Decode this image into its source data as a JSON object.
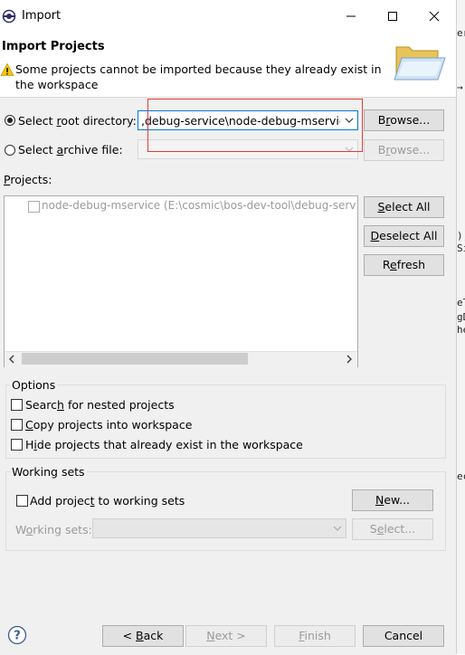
{
  "window": {
    "title": "Import",
    "minimize_icon": "minimize-icon",
    "maximize_icon": "maximize-icon",
    "close_icon": "close-icon"
  },
  "header": {
    "page_title": "Import Projects",
    "warning_icon": "warning-icon",
    "warning_text": "Some projects cannot be imported because they already exist in the workspace",
    "banner_icon": "folder-import-icon"
  },
  "source": {
    "root_directory": {
      "label_pre": "Select ",
      "label_ul": "r",
      "label_post": "oot directory:",
      "value": ",debug-service\\node-debug-mservice",
      "selected": true,
      "browse_pre": "B",
      "browse_ul": "r",
      "browse_post": "owse..."
    },
    "archive_file": {
      "label_pre": "Select ",
      "label_ul": "a",
      "label_post": "rchive file:",
      "value": "",
      "selected": false,
      "browse_pre": "B",
      "browse_ul": "r",
      "browse_post": "owse..."
    }
  },
  "projects": {
    "label_ul": "P",
    "label_post": "rojects:",
    "items": [
      {
        "label": "node-debug-mservice (E:\\cosmic\\bos-dev-tool\\debug-serv",
        "checked": false,
        "disabled": true
      }
    ],
    "buttons": {
      "select_all_ul": "S",
      "select_all_post": "elect All",
      "deselect_all_ul": "D",
      "deselect_all_post": "eselect All",
      "refresh_pre": "R",
      "refresh_ul": "e",
      "refresh_post": "fresh"
    }
  },
  "options": {
    "title": "Options",
    "items": [
      {
        "pre": "Searc",
        "ul": "h",
        "post": " for nested projects",
        "checked": false
      },
      {
        "pre": "",
        "ul": "C",
        "post": "opy projects into workspace",
        "checked": false
      },
      {
        "pre": "H",
        "ul": "i",
        "post": "de projects that already exist in the workspace",
        "checked": false
      }
    ]
  },
  "working_sets": {
    "title": "Working sets",
    "add_pre": "Add projec",
    "add_ul": "t",
    "add_post": " to working sets",
    "add_checked": false,
    "new_ul": "N",
    "new_post": "ew...",
    "sets_pre": "W",
    "sets_ul": "o",
    "sets_post": "rking sets:",
    "select_pre": "S",
    "select_ul": "e",
    "select_post": "lect..."
  },
  "footer": {
    "help_icon": "help-icon",
    "back_pre": "< ",
    "back_ul": "B",
    "back_post": "ack",
    "next_ul": "N",
    "next_post": "ext >",
    "finish_ul": "F",
    "finish_post": "inish",
    "cancel": "Cancel"
  },
  "background_editor": {
    "lines": [
      "er",
      "→",
      ");",
      "Si",
      "eT",
      "gD",
      "he",
      "ec"
    ]
  },
  "colors": {
    "highlight": "#e53935",
    "focus_border": "#0078d7",
    "disabled_text": "#9a9a9a",
    "dialog_bg": "#f0f0f0"
  }
}
